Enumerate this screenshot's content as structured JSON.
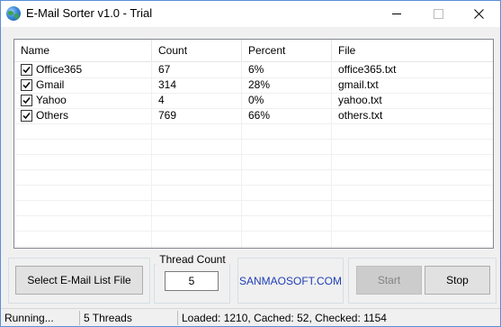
{
  "window": {
    "title": "E-Mail Sorter v1.0 - Trial",
    "icon": "globe-icon"
  },
  "list": {
    "columns": [
      "Name",
      "Count",
      "Percent",
      "File"
    ],
    "rows": [
      {
        "checked": true,
        "name": "Office365",
        "count": "67",
        "percent": "6%",
        "file": "office365.txt"
      },
      {
        "checked": true,
        "name": "Gmail",
        "count": "314",
        "percent": "28%",
        "file": "gmail.txt"
      },
      {
        "checked": true,
        "name": "Yahoo",
        "count": "4",
        "percent": "0%",
        "file": "yahoo.txt"
      },
      {
        "checked": true,
        "name": "Others",
        "count": "769",
        "percent": "66%",
        "file": "others.txt"
      }
    ]
  },
  "controls": {
    "select_button": "Select E-Mail List File",
    "thread_label": "Thread Count",
    "thread_value": "5",
    "link_text": "SANMAOSOFT.COM",
    "start_button": "Start",
    "stop_button": "Stop"
  },
  "status": {
    "state": "Running...",
    "threads": "5 Threads",
    "stats": "Loaded: 1210, Cached: 52, Checked: 1154"
  }
}
